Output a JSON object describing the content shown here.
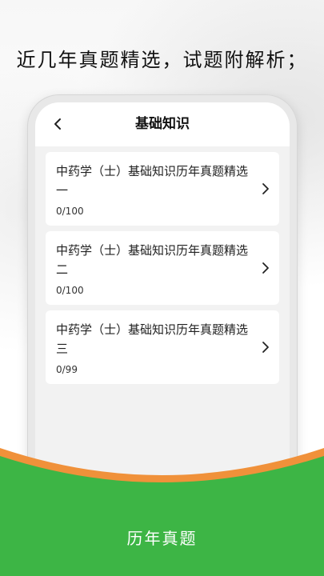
{
  "headline": "近几年真题精选，试题附解析；",
  "screen": {
    "title": "基础知识",
    "items": [
      {
        "title": "中药学（士）基础知识历年真题精选一",
        "progress": "0/100"
      },
      {
        "title": "中药学（士）基础知识历年真题精选二",
        "progress": "0/100"
      },
      {
        "title": "中药学（士）基础知识历年真题精选三",
        "progress": "0/99"
      }
    ]
  },
  "footer": {
    "label": "历年真题"
  },
  "icons": {
    "back": "chevron-left-icon",
    "item_arrow": "chevron-right-icon"
  },
  "colors": {
    "accent_green": "#3db545",
    "accent_orange": "#f0913a"
  }
}
